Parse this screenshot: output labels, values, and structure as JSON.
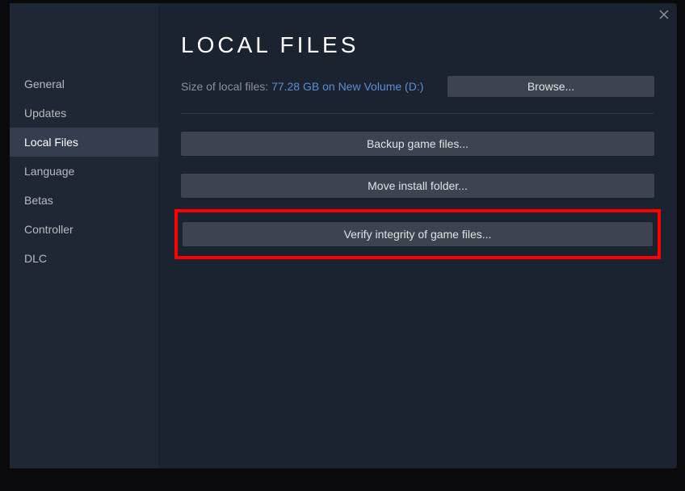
{
  "sidebar": {
    "items": [
      {
        "label": "General"
      },
      {
        "label": "Updates"
      },
      {
        "label": "Local Files"
      },
      {
        "label": "Language"
      },
      {
        "label": "Betas"
      },
      {
        "label": "Controller"
      },
      {
        "label": "DLC"
      }
    ]
  },
  "content": {
    "title": "LOCAL FILES",
    "size_label": "Size of local files: ",
    "size_value": "77.28 GB on New Volume (D:)",
    "browse_label": "Browse...",
    "backup_label": "Backup game files...",
    "move_label": "Move install folder...",
    "verify_label": "Verify integrity of game files..."
  }
}
